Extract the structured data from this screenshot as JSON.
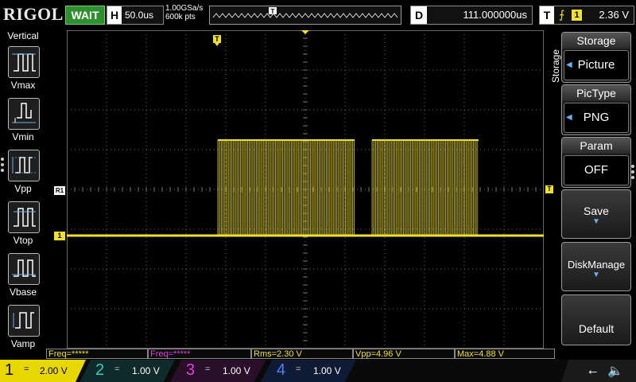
{
  "header": {
    "brand": "RIGOL",
    "run_status": "WAIT",
    "horizontal": {
      "label": "H",
      "timebase": "50.0us"
    },
    "sample": {
      "rate": "1.00GSa/s",
      "depth": "600k pts"
    },
    "delay": {
      "label": "D",
      "value": "111.000000us"
    },
    "trigger": {
      "label": "T",
      "edge_symbol": "⨍",
      "source": "1",
      "level": "2.36 V"
    }
  },
  "left_panel": {
    "title": "Vertical",
    "items": [
      {
        "label": "Vmax",
        "icon": "vmax-icon"
      },
      {
        "label": "Vmin",
        "icon": "vmin-icon"
      },
      {
        "label": "Vpp",
        "icon": "vpp-icon"
      },
      {
        "label": "Vtop",
        "icon": "vtop-icon"
      },
      {
        "label": "Vbase",
        "icon": "vbase-icon"
      },
      {
        "label": "Vamp",
        "icon": "vamp-icon"
      }
    ]
  },
  "markers": {
    "trigger_top": "T",
    "ref_label": "R1",
    "ch1_label": "1",
    "trigger_level_label": "T"
  },
  "right_menu": {
    "title": "Storage",
    "items": [
      {
        "header": "Storage",
        "value": "Picture"
      },
      {
        "header": "PicType",
        "value": "PNG"
      },
      {
        "header": "Param",
        "value": "OFF"
      },
      {
        "label": "Save"
      },
      {
        "label": "DiskManage"
      },
      {
        "label": "Default"
      }
    ]
  },
  "measurements": [
    {
      "text": "Freq=*****",
      "color": "#f0e030"
    },
    {
      "text": "Freq=*****",
      "color": "#e040e0"
    },
    {
      "text": "Rms=2.30 V",
      "color": "#f0e030"
    },
    {
      "text": "Vpp=4.96 V",
      "color": "#f0e030"
    },
    {
      "text": "Max=4.88 V",
      "color": "#f0e030"
    }
  ],
  "channels": [
    {
      "num": "1",
      "coupling": "=",
      "scale": "2.00 V",
      "color": "#e8d800"
    },
    {
      "num": "2",
      "coupling": "=",
      "scale": "1.00 V",
      "color": "#2fd0c0"
    },
    {
      "num": "3",
      "coupling": "=",
      "scale": "1.00 V",
      "color": "#e040e0"
    },
    {
      "num": "4",
      "coupling": "=",
      "scale": "1.00 V",
      "color": "#4f7fff"
    }
  ],
  "system_icons": {
    "usb": "usb-icon",
    "sound": "speaker-muted-icon"
  },
  "colors": {
    "ch1": "#f0e030",
    "grid": "#6a6a6a",
    "accent": "#6aaef0",
    "status": "#2f8f2f"
  }
}
